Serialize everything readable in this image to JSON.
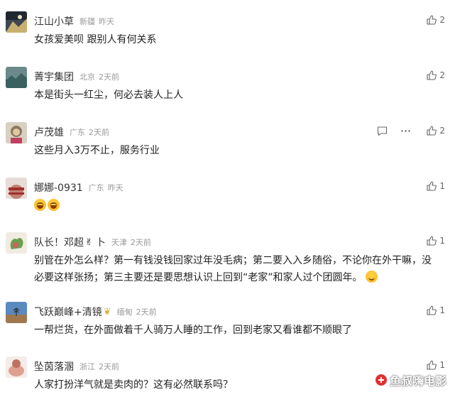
{
  "comments": [
    {
      "username": "江山小草",
      "location": "新疆",
      "time": "昨天",
      "text": "女孩爱美呗  跟别人有何关系",
      "likes": "2"
    },
    {
      "username": "菁宇集团",
      "location": "北京",
      "time": "2天前",
      "text": "本是街头一红尘，何必去装人上人",
      "likes": "2"
    },
    {
      "username": "卢茂雄",
      "location": "广东",
      "time": "2天前",
      "text": "这些月入3万不止，服务行业",
      "likes": "2"
    },
    {
      "username": "娜娜-0931",
      "location": "广东",
      "time": "昨天",
      "text": "",
      "likes": "1"
    },
    {
      "username": "队长！邓超",
      "extra": "卜",
      "location": "天津",
      "time": "2天前",
      "text": "别管在外怎么样？第一有钱没钱回家过年没毛病；第二要入入乡随俗，不论你在外干嘛，没必要这样张扬；第三主要还是要思想认识上回到“老家”和家人过个团圆年。",
      "likes": "1"
    },
    {
      "username": "飞跃巅峰+清镜",
      "location": "缅甸",
      "time": "2天前",
      "text": "一帮烂货，在外面做着千人骑万人睡的工作，回到老家又看谁都不顺眼了",
      "likes": "1"
    },
    {
      "username": "坠茵落溷",
      "location": "浙江",
      "time": "2天前",
      "text": "人家打扮洋气就是卖肉的？这有必然联系吗？",
      "likes": "1"
    }
  ],
  "watermark": "鱼叔嗨电影",
  "icons": {
    "like": "thumbs-up-icon",
    "reply": "reply-bubble-icon",
    "more": "more-dots-icon",
    "emoji_laugh": "laughing-emoji-icon",
    "emoji_smile": "smile-emoji-icon",
    "hand": "victory-hand-emoji-icon",
    "leaf": "leaf-emoji-icon"
  },
  "colors": {
    "username": "#333333",
    "meta": "#9a9a9a",
    "text": "#222222"
  }
}
